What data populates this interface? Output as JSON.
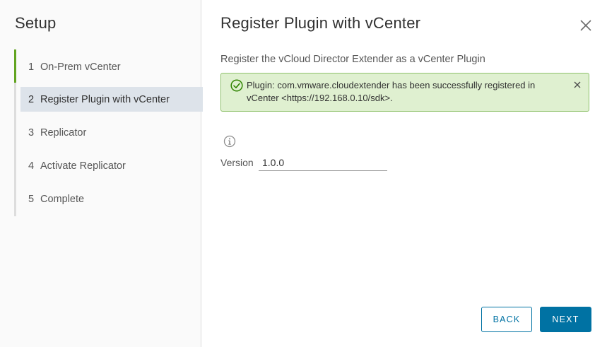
{
  "sidebar": {
    "title": "Setup",
    "steps": [
      {
        "num": "1",
        "label": "On-Prem vCenter"
      },
      {
        "num": "2",
        "label": "Register Plugin with vCenter"
      },
      {
        "num": "3",
        "label": "Replicator"
      },
      {
        "num": "4",
        "label": "Activate Replicator"
      },
      {
        "num": "5",
        "label": "Complete"
      }
    ],
    "active_step": 2
  },
  "main": {
    "title": "Register Plugin with vCenter",
    "subtitle": "Register the vCloud Director Extender as a vCenter Plugin",
    "alert": {
      "type": "success",
      "text": "Plugin: com.vmware.cloudextender has been successfully registered in vCenter <https://192.168.0.10/sdk>."
    },
    "version": {
      "label": "Version",
      "value": "1.0.0"
    }
  },
  "footer": {
    "back_label": "BACK",
    "next_label": "NEXT"
  },
  "colors": {
    "accent": "#0072a3",
    "success_bg": "#dff0d0",
    "success_border": "#8fc16b",
    "progress": "#62a420",
    "active_step_bg": "#dde3ea"
  }
}
